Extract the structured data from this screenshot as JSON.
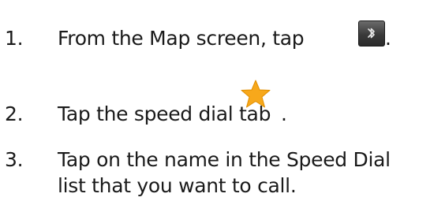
{
  "steps": [
    {
      "number": "1.",
      "text": "From the Map screen, tap",
      "trailing": "."
    },
    {
      "number": "2.",
      "text": "Tap the speed dial tab",
      "trailing": "."
    },
    {
      "number": "3.",
      "line1": "Tap on the name in the Speed Dial",
      "line2": "list that you want to call."
    }
  ],
  "icons": {
    "step1": "bluetooth-icon",
    "step2": "star-icon"
  }
}
